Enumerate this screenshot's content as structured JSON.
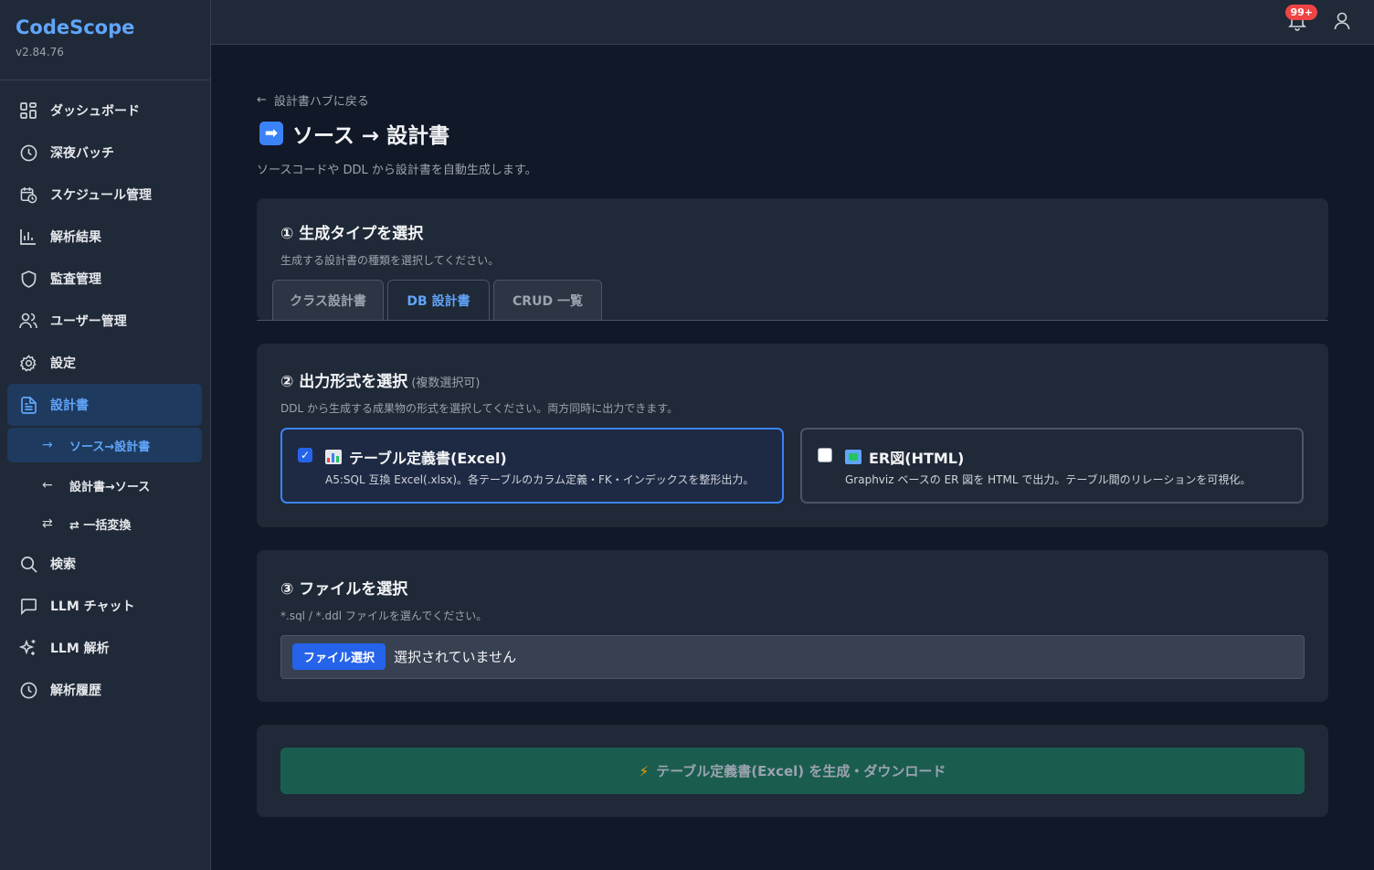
{
  "brand": {
    "name": "CodeScope",
    "version": "v2.84.76"
  },
  "nav": {
    "dashboard": "ダッシュボード",
    "night_batch": "深夜バッチ",
    "schedule": "スケジュール管理",
    "analysis": "解析結果",
    "audit": "監査管理",
    "users": "ユーザー管理",
    "settings": "設定",
    "design_docs": "設計書",
    "sub_src_to_doc": "ソース→設計書",
    "sub_doc_to_src": "設計書→ソース",
    "sub_batch": "⇄ 一括変換",
    "search": "検索",
    "llm_chat": "LLM チャット",
    "llm_analysis": "LLM 解析",
    "history": "解析履歴"
  },
  "topbar": {
    "notification_count": "99+"
  },
  "page": {
    "back_link": "設計書ハブに戻る",
    "title_emoji": "➡",
    "title": "ソース → 設計書",
    "subtitle": "ソースコードや DDL から設計書を自動生成します。"
  },
  "step1": {
    "heading": "① 生成タイプを選択",
    "desc": "生成する設計書の種類を選択してください。",
    "tabs": [
      "クラス設計書",
      "DB 設計書",
      "CRUD 一覧"
    ],
    "active_tab": 1
  },
  "step2": {
    "heading": "② 出力形式を選択",
    "note": "(複数選択可)",
    "desc": "DDL から生成する成果物の形式を選択してください。両方同時に出力できます。",
    "options": [
      {
        "title": "テーブル定義書(Excel)",
        "desc": "A5:SQL 互換 Excel(.xlsx)。各テーブルのカラム定義・FK・インデックスを整形出力。",
        "checked": true,
        "icon": "bar-chart-icon"
      },
      {
        "title": "ER図(HTML)",
        "desc": "Graphviz ベースの ER 図を HTML で出力。テーブル間のリレーションを可視化。",
        "checked": false,
        "icon": "map-icon"
      }
    ]
  },
  "step3": {
    "heading": "③ ファイルを選択",
    "desc": "*.sql / *.ddl ファイルを選んでください。",
    "file_button": "ファイル選択",
    "file_status": "選択されていません"
  },
  "generate": {
    "label": "テーブル定義書(Excel) を生成・ダウンロード",
    "icon": "bolt-icon"
  },
  "colors": {
    "accent": "#60a5fa",
    "primary": "#2563eb",
    "generate_bg": "#1a5d4f",
    "badge": "#ef4444"
  }
}
